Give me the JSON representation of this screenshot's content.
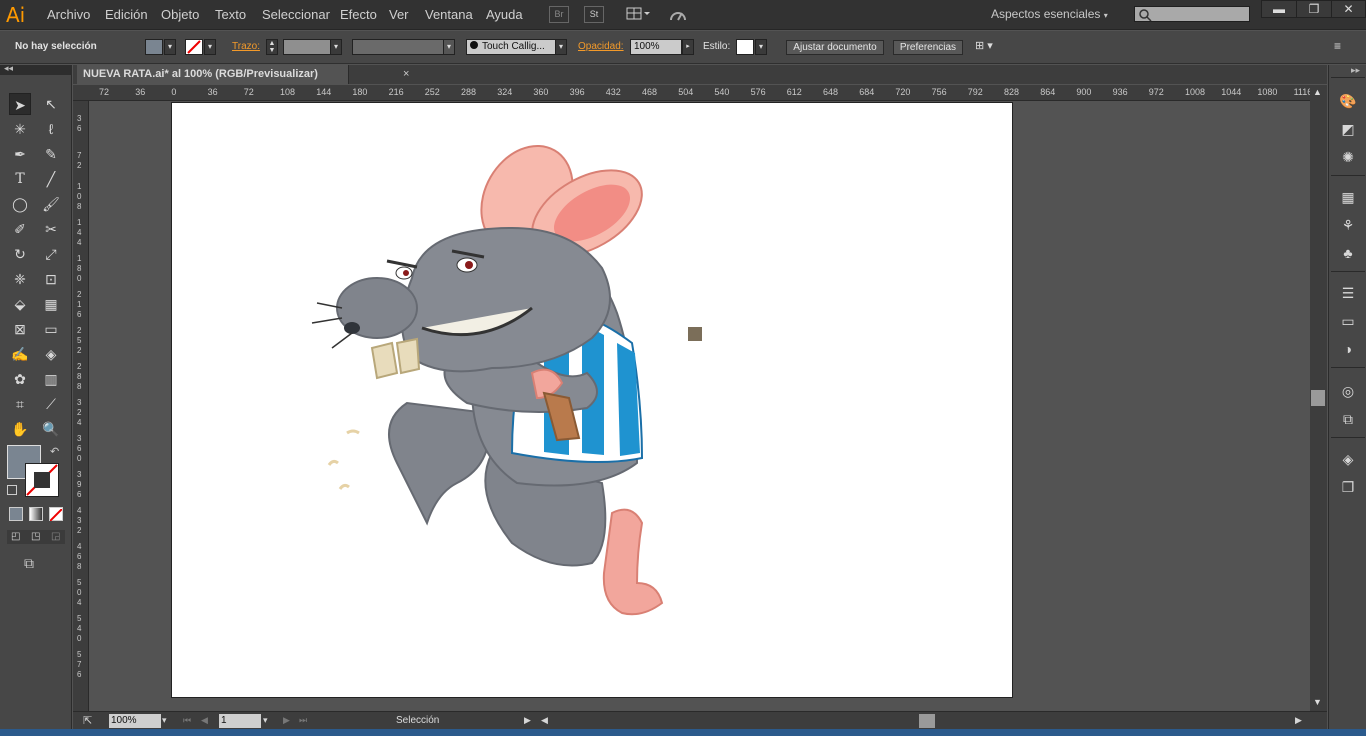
{
  "app": {
    "logo": "Ai"
  },
  "menu": [
    "Archivo",
    "Edición",
    "Objeto",
    "Texto",
    "Seleccionar",
    "Efecto",
    "Ver",
    "Ventana",
    "Ayuda"
  ],
  "menubar_icons": {
    "bridge": "Br",
    "stock": "St"
  },
  "workspace": "Aspectos esenciales",
  "window_controls": {
    "minimize": "▬",
    "restore": "❐",
    "close": "✕"
  },
  "control": {
    "selection_status": "No hay selección",
    "stroke_label": "Trazo:",
    "brush_name": "Touch Callig...",
    "opacity_label": "Opacidad:",
    "opacity_value": "100%",
    "style_label": "Estilo:",
    "fit_document_button": "Ajustar documento",
    "preferences_button": "Preferencias"
  },
  "document_tab": {
    "title": "NUEVA RATA.ai* al 100% (RGB/Previsualizar)",
    "close": "×"
  },
  "ruler": {
    "h_labels": [
      "72",
      "36",
      "0",
      "36",
      "72",
      "108",
      "144",
      "180",
      "216",
      "252",
      "288",
      "324",
      "360",
      "396",
      "432",
      "468",
      "504",
      "540",
      "576",
      "612",
      "648",
      "684",
      "720",
      "756",
      "792",
      "828",
      "864",
      "900",
      "936",
      "972",
      "1008",
      "1044",
      "1080",
      "1116"
    ]
  },
  "status": {
    "zoom": "100%",
    "page": "1",
    "tool": "Selección"
  },
  "colors": {
    "fill": "#7a8591",
    "stroke_none": "#ffffff",
    "accent": "#ff9a00",
    "shirt_blue": "#1f93d0",
    "rat_grey": "#8a8e96",
    "rat_pink": "#f0a39a"
  }
}
